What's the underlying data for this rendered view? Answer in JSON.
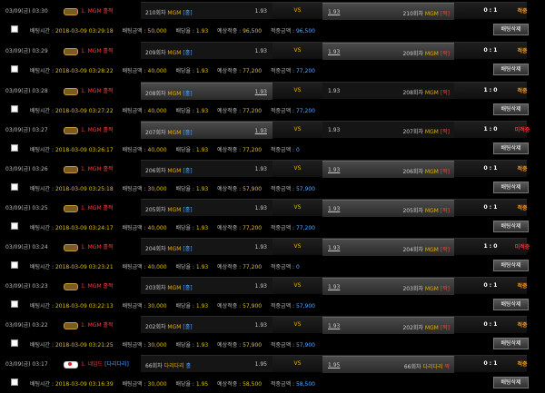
{
  "labels": {
    "bet_time": "배팅시간 :",
    "bet_amount": "배팅금액 :",
    "odds": "배당율 :",
    "expected": "예상적중 :",
    "won": "적중금액 :",
    "vs": "VS",
    "delete_button": "배팅삭제"
  },
  "colors": {
    "win": "#ff9c1a",
    "loss": "#ff2a2a",
    "team": "#e0b000",
    "red": "#ff3b3b",
    "blue": "#4aa0ff"
  },
  "entries": [
    {
      "date": "03/09(금) 03:30",
      "league_icon": "mgm-icon",
      "league": "1. MGM 홀짝",
      "league_extra": "",
      "home_round": "210회차",
      "home_team": "MGM",
      "home_tag": "[홀]",
      "home_odds": "1.93",
      "home_sel": false,
      "away_odds": "1.93",
      "away_round": "210회차",
      "away_team": "MGM",
      "away_tag": "[짝]",
      "away_sel": true,
      "score": "0 : 1",
      "result": "적중",
      "result_type": "win",
      "bet_time": "2018-03-09 03:29:18",
      "bet_amount": "50,000",
      "odds": "1.93",
      "expected": "96,500",
      "won": "96,500"
    },
    {
      "date": "03/09(금) 03:29",
      "league_icon": "mgm-icon",
      "league": "1. MGM 홀짝",
      "league_extra": "",
      "home_round": "209회차",
      "home_team": "MGM",
      "home_tag": "[홀]",
      "home_odds": "1.93",
      "home_sel": false,
      "away_odds": "1.93",
      "away_round": "209회차",
      "away_team": "MGM",
      "away_tag": "[짝]",
      "away_sel": true,
      "score": "0 : 1",
      "result": "적중",
      "result_type": "win",
      "bet_time": "2018-03-09 03:28:22",
      "bet_amount": "40,000",
      "odds": "1.93",
      "expected": "77,200",
      "won": "77,200"
    },
    {
      "date": "03/09(금) 03:28",
      "league_icon": "mgm-icon",
      "league": "1. MGM 홀짝",
      "league_extra": "",
      "home_round": "208회차",
      "home_team": "MGM",
      "home_tag": "[홀]",
      "home_odds": "1.93",
      "home_sel": true,
      "away_odds": "1.93",
      "away_round": "208회차",
      "away_team": "MGM",
      "away_tag": "[짝]",
      "away_sel": false,
      "score": "1 : 0",
      "result": "적중",
      "result_type": "win",
      "bet_time": "2018-03-09 03:27:22",
      "bet_amount": "40,000",
      "odds": "1.93",
      "expected": "77,200",
      "won": "77,200"
    },
    {
      "date": "03/09(금) 03:27",
      "league_icon": "mgm-icon",
      "league": "1. MGM 홀짝",
      "league_extra": "",
      "home_round": "207회차",
      "home_team": "MGM",
      "home_tag": "[홀]",
      "home_odds": "1.93",
      "home_sel": true,
      "away_odds": "1.93",
      "away_round": "207회차",
      "away_team": "MGM",
      "away_tag": "[짝]",
      "away_sel": false,
      "score": "1 : 0",
      "result": "미적중",
      "result_type": "loss",
      "bet_time": "2018-03-09 03:26:17",
      "bet_amount": "40,000",
      "odds": "1.93",
      "expected": "77,200",
      "won": "0"
    },
    {
      "date": "03/09(금) 03:26",
      "league_icon": "mgm-icon",
      "league": "1. MGM 홀짝",
      "league_extra": "",
      "home_round": "206회차",
      "home_team": "MGM",
      "home_tag": "[홀]",
      "home_odds": "1.93",
      "home_sel": false,
      "away_odds": "1.93",
      "away_round": "206회차",
      "away_team": "MGM",
      "away_tag": "[짝]",
      "away_sel": true,
      "score": "0 : 1",
      "result": "적중",
      "result_type": "win",
      "bet_time": "2018-03-09 03:25:18",
      "bet_amount": "30,000",
      "odds": "1.93",
      "expected": "57,900",
      "won": "57,900"
    },
    {
      "date": "03/09(금) 03:25",
      "league_icon": "mgm-icon",
      "league": "1. MGM 홀짝",
      "league_extra": "",
      "home_round": "205회차",
      "home_team": "MGM",
      "home_tag": "[홀]",
      "home_odds": "1.93",
      "home_sel": false,
      "away_odds": "1.93",
      "away_round": "205회차",
      "away_team": "MGM",
      "away_tag": "[짝]",
      "away_sel": true,
      "score": "0 : 1",
      "result": "적중",
      "result_type": "win",
      "bet_time": "2018-03-09 03:24:17",
      "bet_amount": "40,000",
      "odds": "1.93",
      "expected": "77,200",
      "won": "77,200"
    },
    {
      "date": "03/09(금) 03:24",
      "league_icon": "mgm-icon",
      "league": "1. MGM 홀짝",
      "league_extra": "",
      "home_round": "204회차",
      "home_team": "MGM",
      "home_tag": "[홀]",
      "home_odds": "1.93",
      "home_sel": false,
      "away_odds": "1.93",
      "away_round": "204회차",
      "away_team": "MGM",
      "away_tag": "[짝]",
      "away_sel": true,
      "score": "1 : 0",
      "result": "미적중",
      "result_type": "loss",
      "bet_time": "2018-03-09 03:23:21",
      "bet_amount": "40,000",
      "odds": "1.93",
      "expected": "77,200",
      "won": "0"
    },
    {
      "date": "03/09(금) 03:23",
      "league_icon": "mgm-icon",
      "league": "1. MGM 홀짝",
      "league_extra": "",
      "home_round": "203회차",
      "home_team": "MGM",
      "home_tag": "[홀]",
      "home_odds": "1.93",
      "home_sel": false,
      "away_odds": "1.93",
      "away_round": "203회차",
      "away_team": "MGM",
      "away_tag": "[짝]",
      "away_sel": true,
      "score": "0 : 1",
      "result": "적중",
      "result_type": "win",
      "bet_time": "2018-03-09 03:22:13",
      "bet_amount": "30,000",
      "odds": "1.93",
      "expected": "57,900",
      "won": "57,900"
    },
    {
      "date": "03/09(금) 03:22",
      "league_icon": "mgm-icon",
      "league": "1. MGM 홀짝",
      "league_extra": "",
      "home_round": "202회차",
      "home_team": "MGM",
      "home_tag": "[홀]",
      "home_odds": "1.93",
      "home_sel": false,
      "away_odds": "1.93",
      "away_round": "202회차",
      "away_team": "MGM",
      "away_tag": "[짝]",
      "away_sel": true,
      "score": "0 : 1",
      "result": "적중",
      "result_type": "win",
      "bet_time": "2018-03-09 03:21:25",
      "bet_amount": "30,000",
      "odds": "1.93",
      "expected": "57,900",
      "won": "57,900"
    },
    {
      "date": "03/09(금) 03:17",
      "league_icon": "flag-icon",
      "league": "1. 네임드",
      "league_extra": "[다리다리]",
      "home_round": "66회차",
      "home_team": "다리다리",
      "home_tag": "홀",
      "home_odds": "1.95",
      "home_sel": false,
      "away_odds": "1.95",
      "away_round": "66회차",
      "away_team": "다리다리",
      "away_tag": "짝",
      "away_sel": true,
      "score": "0 : 1",
      "result": "적중",
      "result_type": "win",
      "bet_time": "2018-03-09 03:16:39",
      "bet_amount": "30,000",
      "odds": "1.95",
      "expected": "58,500",
      "won": "58,500"
    }
  ]
}
